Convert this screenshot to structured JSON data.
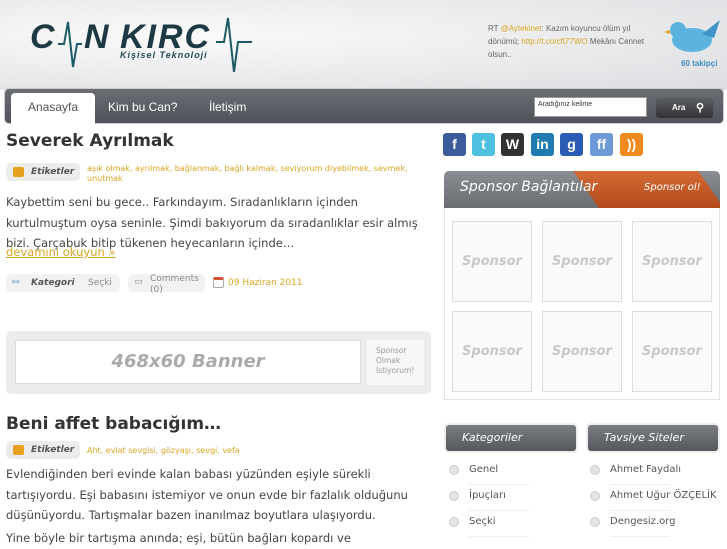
{
  "header": {
    "logo_text": "CAN KIRCA",
    "logo_subtitle": "Kişisel Teknoloji",
    "tweet": {
      "prefix": "RT ",
      "mention": "@Aytekinet",
      "text1": ": Kazım koyuncu ölüm yıl dönümü; ",
      "link": "http://t.co/cft77WO",
      "text2": " Mekânı Cennet olsun.."
    },
    "followers": "60 takipçi"
  },
  "nav": {
    "tabs": [
      {
        "label": "Anasayfa",
        "active": true
      },
      {
        "label": "Kim bu Can?"
      },
      {
        "label": "İletişim"
      }
    ],
    "search_value": "Aradığınız kelime",
    "search_button": "Ara"
  },
  "posts": [
    {
      "title": "Severek Ayrılmak",
      "tags_label": "Etiketler",
      "tags": "aşık olmak, ayrılmak, bağlanmak, bağlı kalmak, seviyorum diyebilmek, sevmek, unutmak",
      "body": "Kaybettim seni bu gece.. Farkındayım. Sıradanlıkların içinden kurtulmuştum oysa seninle. Şimdi bakıyorum da sıradanlıklar esir almış bizi. Çarçabuk bitip tükenen heyecanların içinde…",
      "more": "devamını okuyun »",
      "category_label": "Kategori",
      "category": "Seçki",
      "comments": "Comments",
      "comments_count": "(0)",
      "date": "09 Haziran 2011"
    },
    {
      "title": "Beni affet babacığım…",
      "tags_label": "Etiketler",
      "tags": "Aht, evlat sevgisi, gözyaşı, sevgi, vefa",
      "body": "Evlendiğinden beri evinde kalan babası yüzünden eşiyle sürekli tartışıyordu. Eşi babasını istemiyor ve onun evde bir fazlalık olduğunu düşünüyordu. Tartışmalar bazen inanılmaz boyutlara ulaşıyordu.",
      "body2": "Yine böyle bir tartışma anında; eşi, bütün bağları kopardı ve"
    }
  ],
  "banner": {
    "text": "468x60 Banner",
    "side": "Sponsor Olmak İstiyorum!"
  },
  "sidebar": {
    "social": [
      {
        "name": "facebook",
        "glyph": "f",
        "color": "#3b5b9a"
      },
      {
        "name": "twitter",
        "glyph": "t",
        "color": "#4fc1e0"
      },
      {
        "name": "wordpress",
        "glyph": "W",
        "color": "#333333"
      },
      {
        "name": "linkedin",
        "glyph": "in",
        "color": "#1f7bb0"
      },
      {
        "name": "google",
        "glyph": "g",
        "color": "#2a5bb5"
      },
      {
        "name": "friendfeed",
        "glyph": "ff",
        "color": "#6b9ad6"
      },
      {
        "name": "rss",
        "glyph": "))",
        "color": "#f08a1e"
      }
    ],
    "sponsor_title": "Sponsor Bağlantılar",
    "sponsor_cta": "Sponsor ol!",
    "sponsor_slot": "Sponsor",
    "categories_title": "Kategoriler",
    "categories": [
      "Genel",
      "İpuçları",
      "Seçki"
    ],
    "links_title": "Tavsiye Siteler",
    "links": [
      "Ahmet Faydalı",
      "Ahmet Uğur ÖZÇELİK",
      "Dengesiz.org"
    ]
  }
}
